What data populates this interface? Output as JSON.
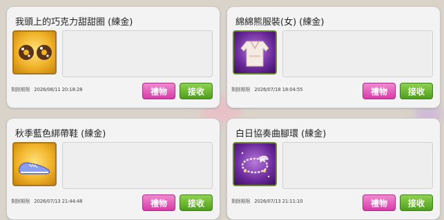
{
  "colors": {
    "gift_button": "#d73ba8",
    "receive_button": "#4f9e1f",
    "card_bg": "#f3f3f3"
  },
  "cards": [
    {
      "title": "我頭上的巧克力甜甜圈 (練金)",
      "time_label": "剩餘期限",
      "time": "2026/08/11 20:18:28",
      "icon": "chocolate-donut-icon",
      "gift_label": "禮物",
      "receive_label": "接收"
    },
    {
      "title": "綿綿熊服裝(女) (練金)",
      "time_label": "剩餘期限",
      "time": "2026/07/18 18:04:55",
      "icon": "bear-outfit-icon",
      "gift_label": "禮物",
      "receive_label": "接收"
    },
    {
      "title": "秋季藍色綁帶鞋 (練金)",
      "time_label": "剩餘期限",
      "time": "2026/07/13 21:44:48",
      "icon": "blue-sneaker-icon",
      "gift_label": "禮物",
      "receive_label": "接收"
    },
    {
      "title": "白日協奏曲腳環 (練金)",
      "time_label": "剩餘期限",
      "time": "2026/07/13 21:11:10",
      "icon": "anklet-icon",
      "gift_label": "禮物",
      "receive_label": "接收"
    }
  ]
}
